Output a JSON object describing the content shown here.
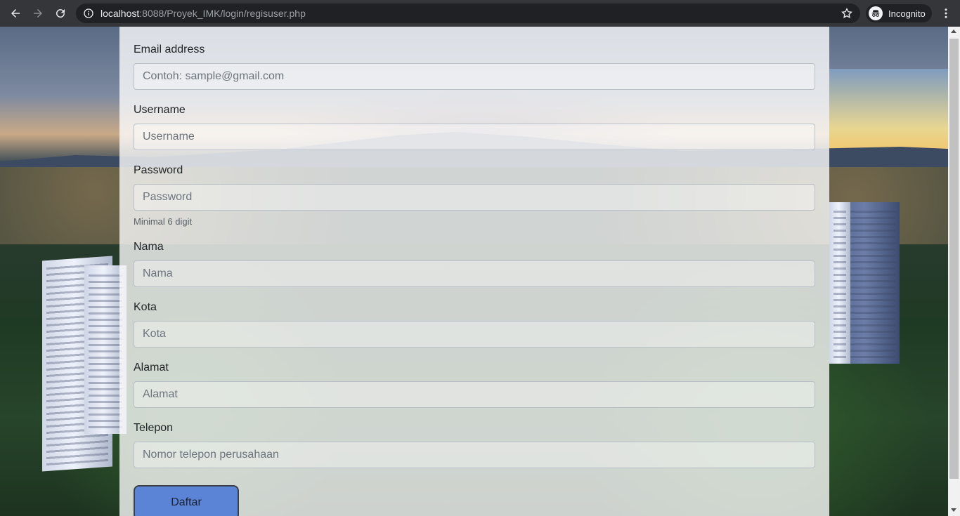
{
  "browser": {
    "url_host": "localhost",
    "url_rest": ":8088/Proyek_IMK/login/regisuser.php",
    "profile_label": "Incognito",
    "icons": [
      "back-icon",
      "forward-icon",
      "reload-icon",
      "info-icon",
      "star-icon",
      "incognito-icon",
      "more-vert-icon"
    ]
  },
  "form": {
    "email": {
      "label": "Email address",
      "placeholder": "Contoh: sample@gmail.com"
    },
    "username": {
      "label": "Username",
      "placeholder": "Username"
    },
    "password": {
      "label": "Password",
      "placeholder": "Password",
      "help": "Minimal 6 digit"
    },
    "nama": {
      "label": "Nama",
      "placeholder": "Nama"
    },
    "kota": {
      "label": "Kota",
      "placeholder": "Kota"
    },
    "alamat": {
      "label": "Alamat",
      "placeholder": "Alamat"
    },
    "telepon": {
      "label": "Telepon",
      "placeholder": "Nomor telepon perusahaan"
    },
    "submit_label": "Daftar"
  },
  "colors": {
    "chrome_bg": "#35363a",
    "omnibox_bg": "#202124",
    "button_blue": "#5b84d6"
  }
}
